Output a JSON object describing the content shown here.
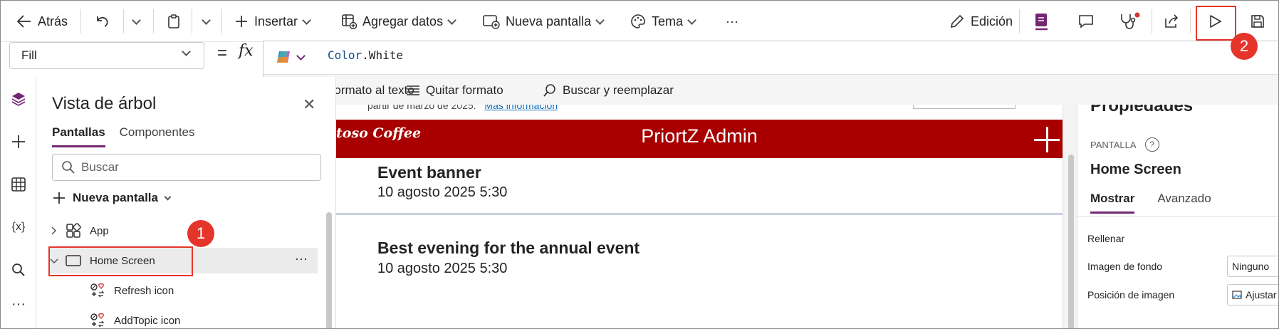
{
  "toolbar": {
    "back_label": "Atrás",
    "insert_label": "Insertar",
    "add_data_label": "Agregar datos",
    "new_screen_label": "Nueva pantalla",
    "theme_label": "Tema",
    "more_label": "···",
    "edit_label": "Edición"
  },
  "formula": {
    "property": "Fill",
    "equals": "=",
    "fx": "fx",
    "expression_obj": "Color",
    "expression_prop": ".White",
    "tools": {
      "format_text": "Aplicar formato al texto",
      "remove_format": "Quitar formato",
      "find_replace": "Buscar y reemplazar"
    }
  },
  "tree": {
    "title": "Vista de árbol",
    "tabs": [
      "Pantallas",
      "Componentes"
    ],
    "search_placeholder": "Buscar",
    "new_screen_label": "Nueva pantalla",
    "items": [
      {
        "label": "App"
      },
      {
        "label": "Home Screen"
      },
      {
        "label": "Refresh icon"
      },
      {
        "label": "AddTopic icon"
      }
    ],
    "more": "···"
  },
  "canvas": {
    "banner_text": "partir de marzo de 2025.",
    "banner_link": "Más información",
    "app_logo": "toso Coffee",
    "app_title": "PriortZ Admin",
    "events": [
      {
        "title": "Event banner",
        "date": "10 agosto 2025 5:30"
      },
      {
        "title": "Best evening for the annual event",
        "date": "10 agosto 2025 5:30"
      }
    ]
  },
  "properties": {
    "title": "Propiedades",
    "kind": "PANTALLA",
    "screen_name": "Home Screen",
    "tabs": [
      "Mostrar",
      "Avanzado"
    ],
    "rows": [
      {
        "label": "Rellenar",
        "value": ""
      },
      {
        "label": "Imagen de fondo",
        "value": "Ninguno"
      },
      {
        "label": "Posición de imagen",
        "value": "Ajustar"
      }
    ]
  },
  "annotations": {
    "badge_1": "1",
    "badge_2": "2"
  },
  "colors": {
    "accent": "#742774",
    "app_header": "#a80000",
    "highlight": "#e5352b"
  }
}
